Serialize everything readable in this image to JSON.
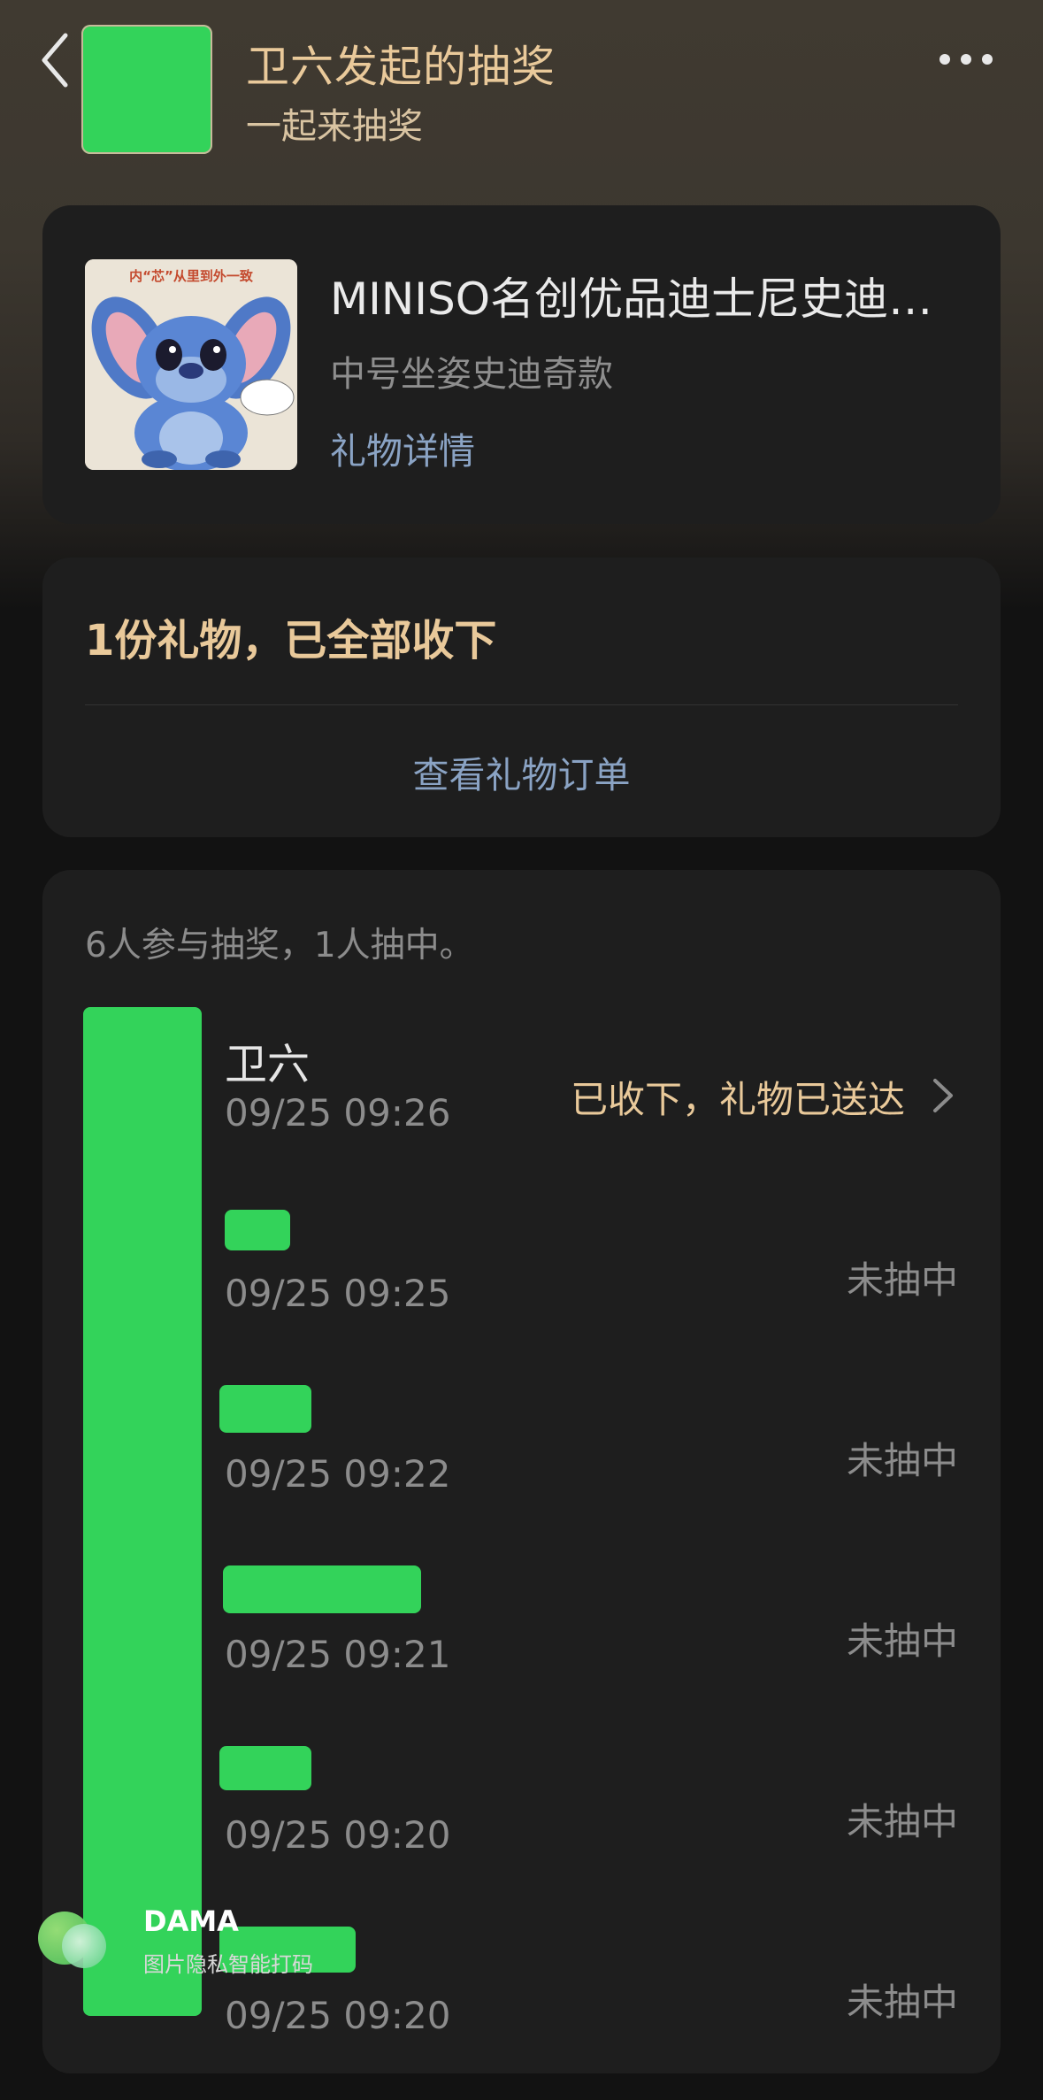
{
  "header": {
    "title": "卫六发起的抽奖",
    "subtitle": "一起来抽奖"
  },
  "gift": {
    "name": "MINISO名创优品迪士尼史迪…",
    "variant": "中号坐姿史迪奇款",
    "detail_link": "礼物详情",
    "image_caption": "内“芯”从里到外一致"
  },
  "status": {
    "summary": "1份礼物，已全部收下",
    "order_link": "查看礼物订单"
  },
  "participants": {
    "summary": "6人参与抽奖，1人抽中。",
    "list": [
      {
        "name": "卫六",
        "time": "09/25 09:26",
        "status": "已收下，礼物已送达"
      },
      {
        "name": "",
        "time": "09/25 09:25",
        "status": "未抽中"
      },
      {
        "name": "",
        "time": "09/25 09:22",
        "status": "未抽中"
      },
      {
        "name": "",
        "time": "09/25 09:21",
        "status": "未抽中"
      },
      {
        "name": "",
        "time": "09/25 09:20",
        "status": "未抽中"
      },
      {
        "name": "",
        "time": "09/25 09:20",
        "status": "未抽中"
      }
    ]
  },
  "watermark": {
    "title": "DAMA",
    "subtitle": "图片隐私智能打码"
  },
  "colors": {
    "background": "#121212",
    "card": "#1e1e1e",
    "gold": "#e9c99a",
    "link": "#8aa3c4",
    "mask_green": "#33d35a",
    "muted": "#8c8c8c"
  }
}
